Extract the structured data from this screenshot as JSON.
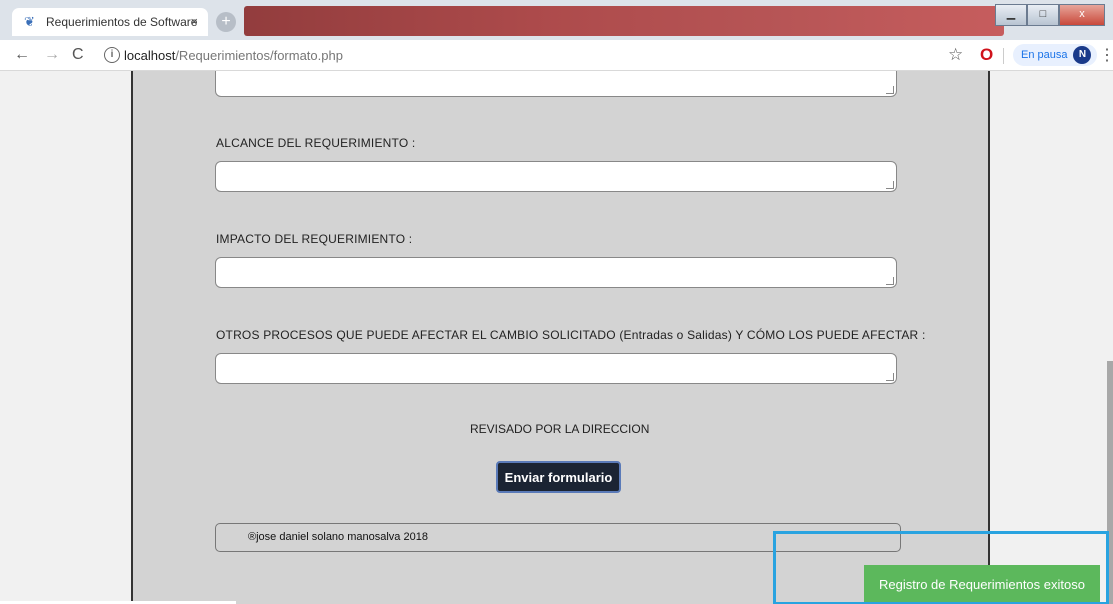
{
  "tab": {
    "title": "Requerimientos de Software",
    "close": "×",
    "new_tab": "+"
  },
  "window": {
    "minimize": "▁",
    "maximize": "□",
    "close": "x"
  },
  "address": {
    "host": "localhost",
    "path": "/Requerimientos/formato.php"
  },
  "profile": {
    "status": "En pausa",
    "initial": "N"
  },
  "form": {
    "alcance_label": "ALCANCE DEL REQUERIMIENTO :",
    "impacto_label": "IMPACTO DEL REQUERIMIENTO :",
    "otros_label": "OTROS PROCESOS QUE PUEDE AFECTAR EL CAMBIO SOLICITADO (Entradas o Salidas) Y CÓMO LOS PUEDE AFECTAR :",
    "review_text": "REVISADO POR LA DIRECCION",
    "submit_label": "Enviar formulario",
    "footer_text": "®jose daniel solano manosalva 2018"
  },
  "toast": {
    "message": "Registro de Requerimientos exitoso",
    "color": "#5cb85c"
  },
  "colors": {
    "highlight": "#29a3e0",
    "sheet": "#d3d3d3",
    "button": "#1b2433"
  }
}
